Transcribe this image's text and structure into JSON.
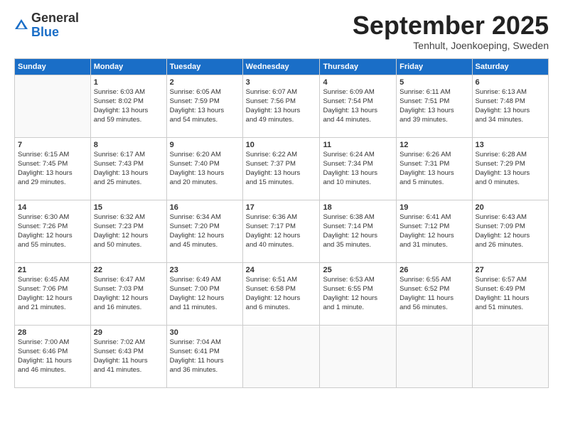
{
  "header": {
    "logo": {
      "general": "General",
      "blue": "Blue"
    },
    "month": "September 2025",
    "location": "Tenhult, Joenkoeping, Sweden"
  },
  "days_of_week": [
    "Sunday",
    "Monday",
    "Tuesday",
    "Wednesday",
    "Thursday",
    "Friday",
    "Saturday"
  ],
  "weeks": [
    [
      {
        "day": "",
        "info": ""
      },
      {
        "day": "1",
        "info": "Sunrise: 6:03 AM\nSunset: 8:02 PM\nDaylight: 13 hours\nand 59 minutes."
      },
      {
        "day": "2",
        "info": "Sunrise: 6:05 AM\nSunset: 7:59 PM\nDaylight: 13 hours\nand 54 minutes."
      },
      {
        "day": "3",
        "info": "Sunrise: 6:07 AM\nSunset: 7:56 PM\nDaylight: 13 hours\nand 49 minutes."
      },
      {
        "day": "4",
        "info": "Sunrise: 6:09 AM\nSunset: 7:54 PM\nDaylight: 13 hours\nand 44 minutes."
      },
      {
        "day": "5",
        "info": "Sunrise: 6:11 AM\nSunset: 7:51 PM\nDaylight: 13 hours\nand 39 minutes."
      },
      {
        "day": "6",
        "info": "Sunrise: 6:13 AM\nSunset: 7:48 PM\nDaylight: 13 hours\nand 34 minutes."
      }
    ],
    [
      {
        "day": "7",
        "info": "Sunrise: 6:15 AM\nSunset: 7:45 PM\nDaylight: 13 hours\nand 29 minutes."
      },
      {
        "day": "8",
        "info": "Sunrise: 6:17 AM\nSunset: 7:43 PM\nDaylight: 13 hours\nand 25 minutes."
      },
      {
        "day": "9",
        "info": "Sunrise: 6:20 AM\nSunset: 7:40 PM\nDaylight: 13 hours\nand 20 minutes."
      },
      {
        "day": "10",
        "info": "Sunrise: 6:22 AM\nSunset: 7:37 PM\nDaylight: 13 hours\nand 15 minutes."
      },
      {
        "day": "11",
        "info": "Sunrise: 6:24 AM\nSunset: 7:34 PM\nDaylight: 13 hours\nand 10 minutes."
      },
      {
        "day": "12",
        "info": "Sunrise: 6:26 AM\nSunset: 7:31 PM\nDaylight: 13 hours\nand 5 minutes."
      },
      {
        "day": "13",
        "info": "Sunrise: 6:28 AM\nSunset: 7:29 PM\nDaylight: 13 hours\nand 0 minutes."
      }
    ],
    [
      {
        "day": "14",
        "info": "Sunrise: 6:30 AM\nSunset: 7:26 PM\nDaylight: 12 hours\nand 55 minutes."
      },
      {
        "day": "15",
        "info": "Sunrise: 6:32 AM\nSunset: 7:23 PM\nDaylight: 12 hours\nand 50 minutes."
      },
      {
        "day": "16",
        "info": "Sunrise: 6:34 AM\nSunset: 7:20 PM\nDaylight: 12 hours\nand 45 minutes."
      },
      {
        "day": "17",
        "info": "Sunrise: 6:36 AM\nSunset: 7:17 PM\nDaylight: 12 hours\nand 40 minutes."
      },
      {
        "day": "18",
        "info": "Sunrise: 6:38 AM\nSunset: 7:14 PM\nDaylight: 12 hours\nand 35 minutes."
      },
      {
        "day": "19",
        "info": "Sunrise: 6:41 AM\nSunset: 7:12 PM\nDaylight: 12 hours\nand 31 minutes."
      },
      {
        "day": "20",
        "info": "Sunrise: 6:43 AM\nSunset: 7:09 PM\nDaylight: 12 hours\nand 26 minutes."
      }
    ],
    [
      {
        "day": "21",
        "info": "Sunrise: 6:45 AM\nSunset: 7:06 PM\nDaylight: 12 hours\nand 21 minutes."
      },
      {
        "day": "22",
        "info": "Sunrise: 6:47 AM\nSunset: 7:03 PM\nDaylight: 12 hours\nand 16 minutes."
      },
      {
        "day": "23",
        "info": "Sunrise: 6:49 AM\nSunset: 7:00 PM\nDaylight: 12 hours\nand 11 minutes."
      },
      {
        "day": "24",
        "info": "Sunrise: 6:51 AM\nSunset: 6:58 PM\nDaylight: 12 hours\nand 6 minutes."
      },
      {
        "day": "25",
        "info": "Sunrise: 6:53 AM\nSunset: 6:55 PM\nDaylight: 12 hours\nand 1 minute."
      },
      {
        "day": "26",
        "info": "Sunrise: 6:55 AM\nSunset: 6:52 PM\nDaylight: 11 hours\nand 56 minutes."
      },
      {
        "day": "27",
        "info": "Sunrise: 6:57 AM\nSunset: 6:49 PM\nDaylight: 11 hours\nand 51 minutes."
      }
    ],
    [
      {
        "day": "28",
        "info": "Sunrise: 7:00 AM\nSunset: 6:46 PM\nDaylight: 11 hours\nand 46 minutes."
      },
      {
        "day": "29",
        "info": "Sunrise: 7:02 AM\nSunset: 6:43 PM\nDaylight: 11 hours\nand 41 minutes."
      },
      {
        "day": "30",
        "info": "Sunrise: 7:04 AM\nSunset: 6:41 PM\nDaylight: 11 hours\nand 36 minutes."
      },
      {
        "day": "",
        "info": ""
      },
      {
        "day": "",
        "info": ""
      },
      {
        "day": "",
        "info": ""
      },
      {
        "day": "",
        "info": ""
      }
    ]
  ]
}
